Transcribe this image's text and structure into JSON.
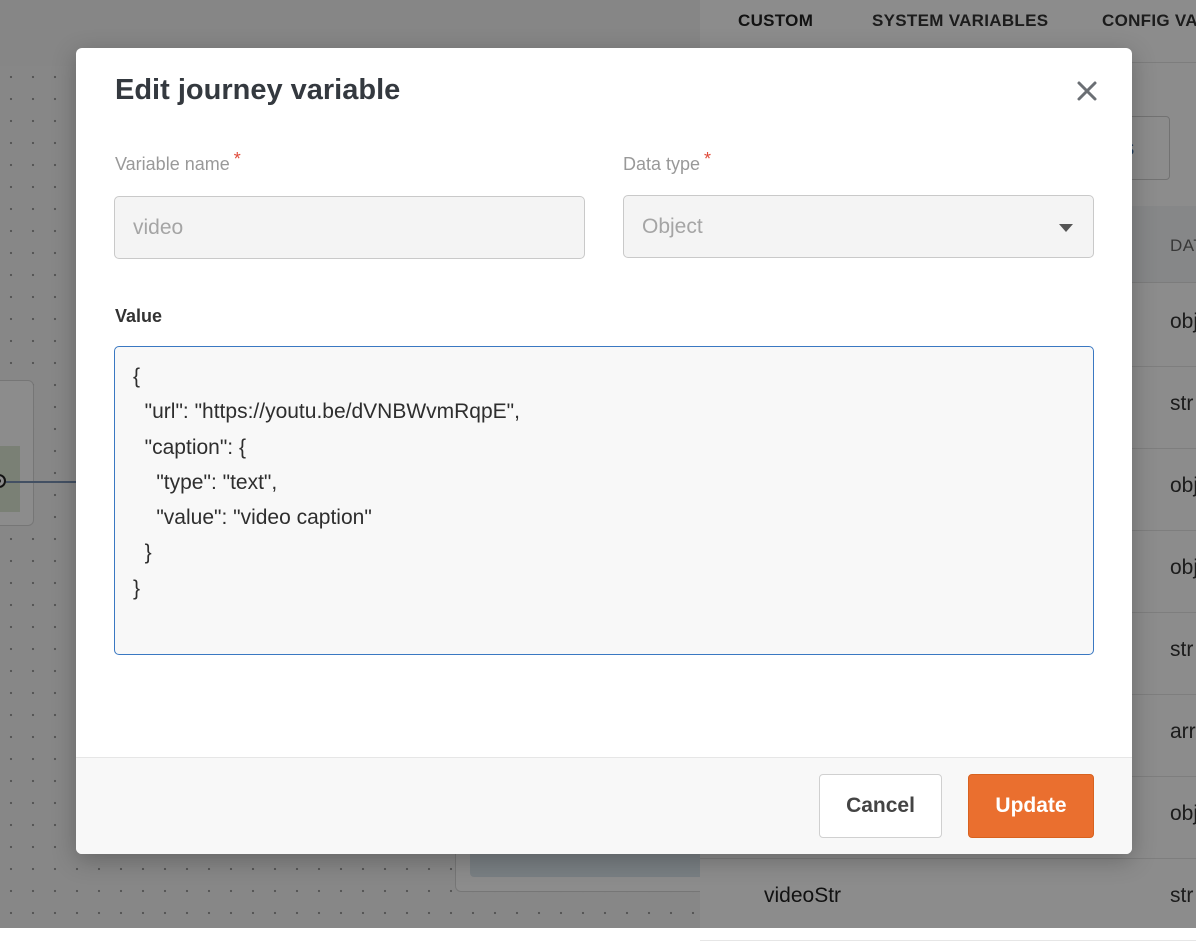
{
  "background": {
    "tabs": [
      "CUSTOM",
      "SYSTEM VARIABLES",
      "CONFIG VA"
    ],
    "partial_button_text": "es",
    "table_header_col2": "DAT",
    "rows": [
      {
        "name": "",
        "type": "obj"
      },
      {
        "name": "",
        "type": "str"
      },
      {
        "name": "",
        "type": "obj"
      },
      {
        "name": "",
        "type": "obj"
      },
      {
        "name": "",
        "type": "str"
      },
      {
        "name": "",
        "type": "arr"
      },
      {
        "name": "",
        "type": "obj"
      },
      {
        "name": "videoStr",
        "type": "str"
      }
    ]
  },
  "modal": {
    "title": "Edit journey variable",
    "close_icon": "close-icon",
    "variable_name": {
      "label": "Variable name",
      "required_mark": "*",
      "value": "video"
    },
    "data_type": {
      "label": "Data type",
      "required_mark": "*",
      "selected": "Object"
    },
    "value": {
      "label": "Value",
      "content": "{\n  \"url\": \"https://youtu.be/dVNBWvmRqpE\",\n  \"caption\": {\n    \"type\": \"text\",\n    \"value\": \"video caption\"\n  }\n}"
    },
    "cancel_label": "Cancel",
    "update_label": "Update"
  },
  "colors": {
    "accent": "#ea6f2f",
    "focus_border": "#3a78c2",
    "required": "#e04a3a"
  }
}
